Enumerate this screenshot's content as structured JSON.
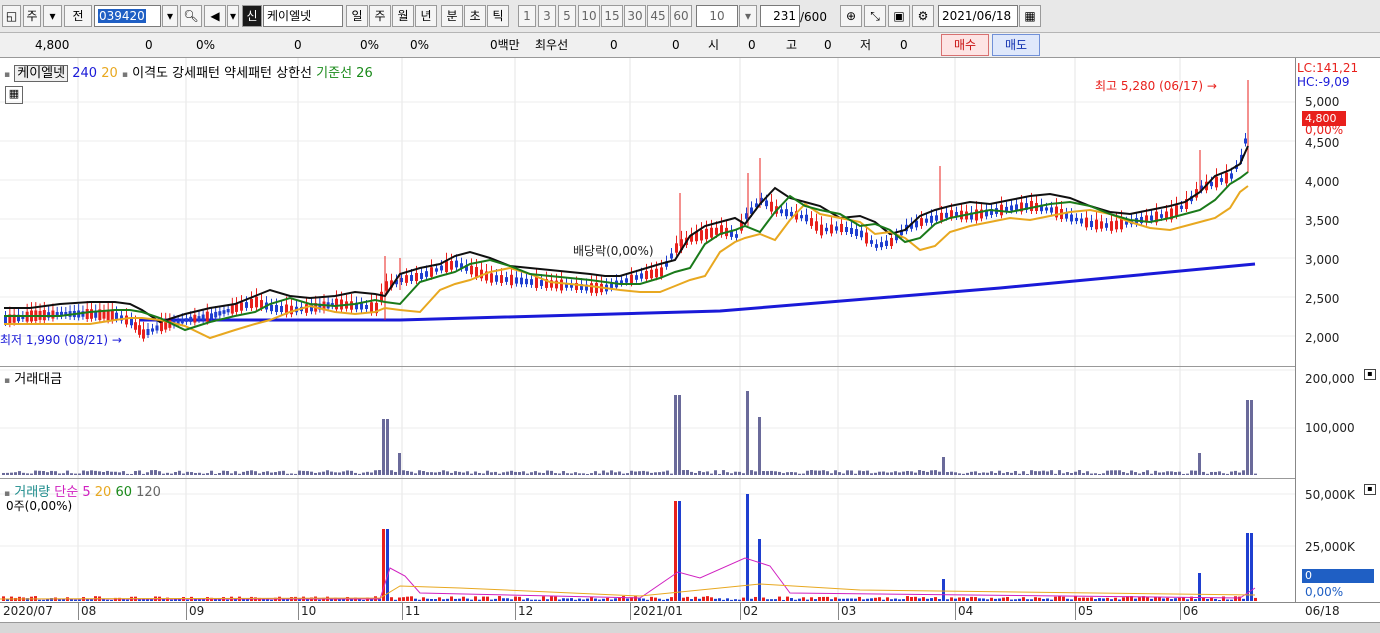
{
  "toolbar": {
    "type_label": "주",
    "prev_label": "전",
    "stock_code": "039420",
    "new_badge": "신",
    "stock_name": "케이엘넷",
    "period_tabs": [
      "일",
      "주",
      "월",
      "년",
      "분",
      "초",
      "틱"
    ],
    "selected_period": "일",
    "interval_options": [
      "1",
      "3",
      "5",
      "10",
      "15",
      "30",
      "45",
      "60"
    ],
    "interval_value": "10",
    "count_value": "231",
    "count_total": "/600",
    "date": "2021/06/18"
  },
  "quote_bar": {
    "price": "4,800",
    "change": "0",
    "change_pct": "0%",
    "volume": "0",
    "vol_pct1": "0%",
    "vol_pct2": "0%",
    "amount": "0백만",
    "bid_label": "최우선",
    "bid": "0",
    "ask": "0",
    "open_label": "시",
    "open": "0",
    "high_label": "고",
    "high": "0",
    "low_label": "저",
    "low": "0",
    "buy_label": "매수",
    "sell_label": "매도"
  },
  "price_panel": {
    "name": "케이엘넷",
    "ma240": "240",
    "ma20": "20",
    "indicators": [
      "이격도",
      "강세패턴",
      "약세패턴",
      "상한선"
    ],
    "base_line": "기준선 26",
    "high_annotation": "최고 5,280 (06/17)",
    "low_annotation": "최저 1,990 (08/21)",
    "dividend_annotation": "배당락(0,00%)",
    "lc": "LC:141,21",
    "hc": "HC:-9,09",
    "current_price": "4,800",
    "current_pct": "0,00%",
    "y_ticks": [
      "5,000",
      "4,500",
      "4,000",
      "3,500",
      "3,000",
      "2,500",
      "2,000"
    ]
  },
  "amount_panel": {
    "title": "거래대금",
    "y_ticks": [
      "200,000",
      "100,000"
    ]
  },
  "volume_panel": {
    "title": "거래량",
    "ma_label": "단순 5",
    "ma20": "20",
    "ma60": "60",
    "ma120": "120",
    "sub_label": "0주(0,00%)",
    "y_ticks": [
      "50,000K",
      "25,000K"
    ],
    "current_value": "0",
    "current_pct": "0,00%"
  },
  "x_axis": {
    "labels": [
      "2020/07",
      "08",
      "09",
      "10",
      "11",
      "12",
      "2021/01",
      "02",
      "03",
      "04",
      "05",
      "06"
    ],
    "right_label": "06/18"
  },
  "colors": {
    "up": "#e8201c",
    "down": "#1f3fd0",
    "ma5": "#101010",
    "ma20": "#e8a820",
    "ma60": "#1a7a1a",
    "ma240": "#1a1ad8",
    "amount_bar": "#6a6a9a"
  }
}
